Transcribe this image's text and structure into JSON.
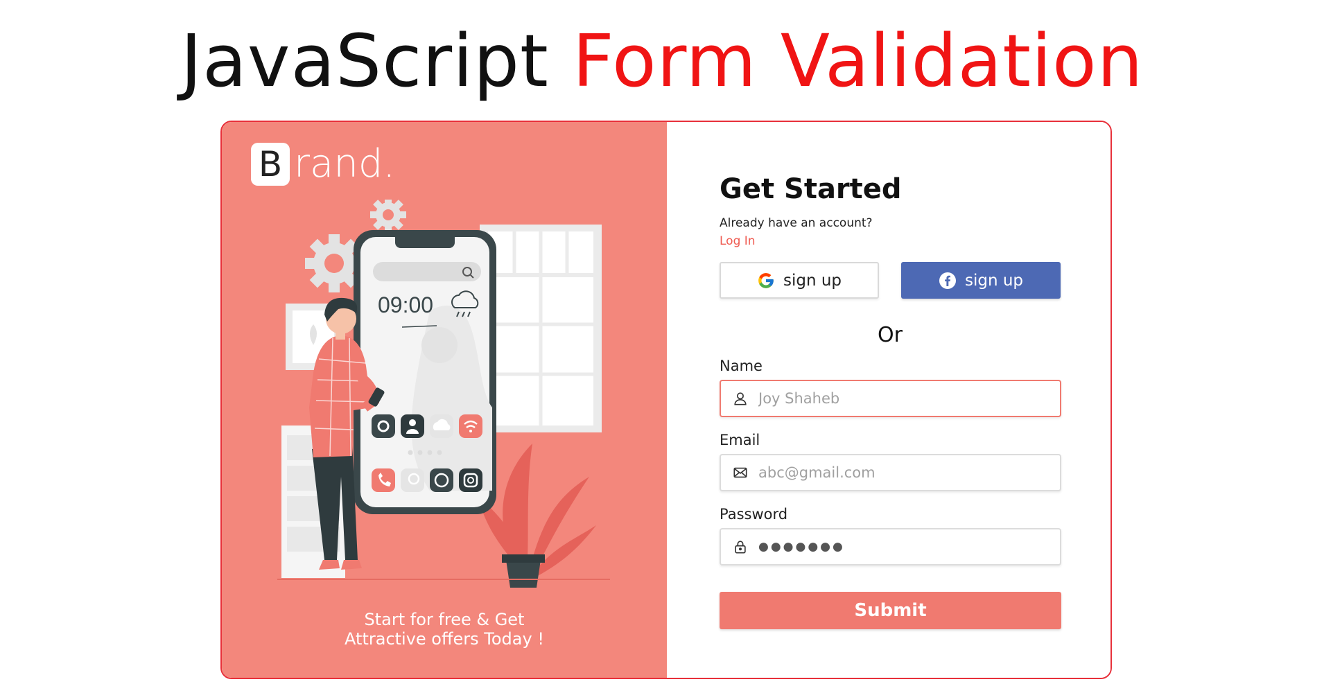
{
  "headline": {
    "part1": "JavaScript",
    "part2": "Form Validation"
  },
  "brand": {
    "letter": "B",
    "rest": "rand."
  },
  "illustration": {
    "clock_time": "09:00"
  },
  "promo": {
    "line1": "Start for free & Get",
    "line2": "Attractive offers Today !"
  },
  "form": {
    "title": "Get Started",
    "already_text": "Already have an account?",
    "login_link": "Log In",
    "google_button": "sign up",
    "facebook_button": "sign up",
    "or_text": "Or",
    "name_label": "Name",
    "name_placeholder": "Joy Shaheb",
    "email_label": "Email",
    "email_placeholder": "abc@gmail.com",
    "password_label": "Password",
    "password_value": "●●●●●●●",
    "submit_label": "Submit"
  },
  "icons": {
    "google": "google-icon",
    "facebook": "facebook-icon",
    "user": "user-icon",
    "mail": "mail-icon",
    "lock": "lock-icon"
  },
  "colors": {
    "headline_accent": "#f01414",
    "panel": "#f3877c",
    "card_border": "#e8303a",
    "facebook": "#4d69b4",
    "submit": "#f07a70",
    "login_link": "#ef5a50"
  }
}
